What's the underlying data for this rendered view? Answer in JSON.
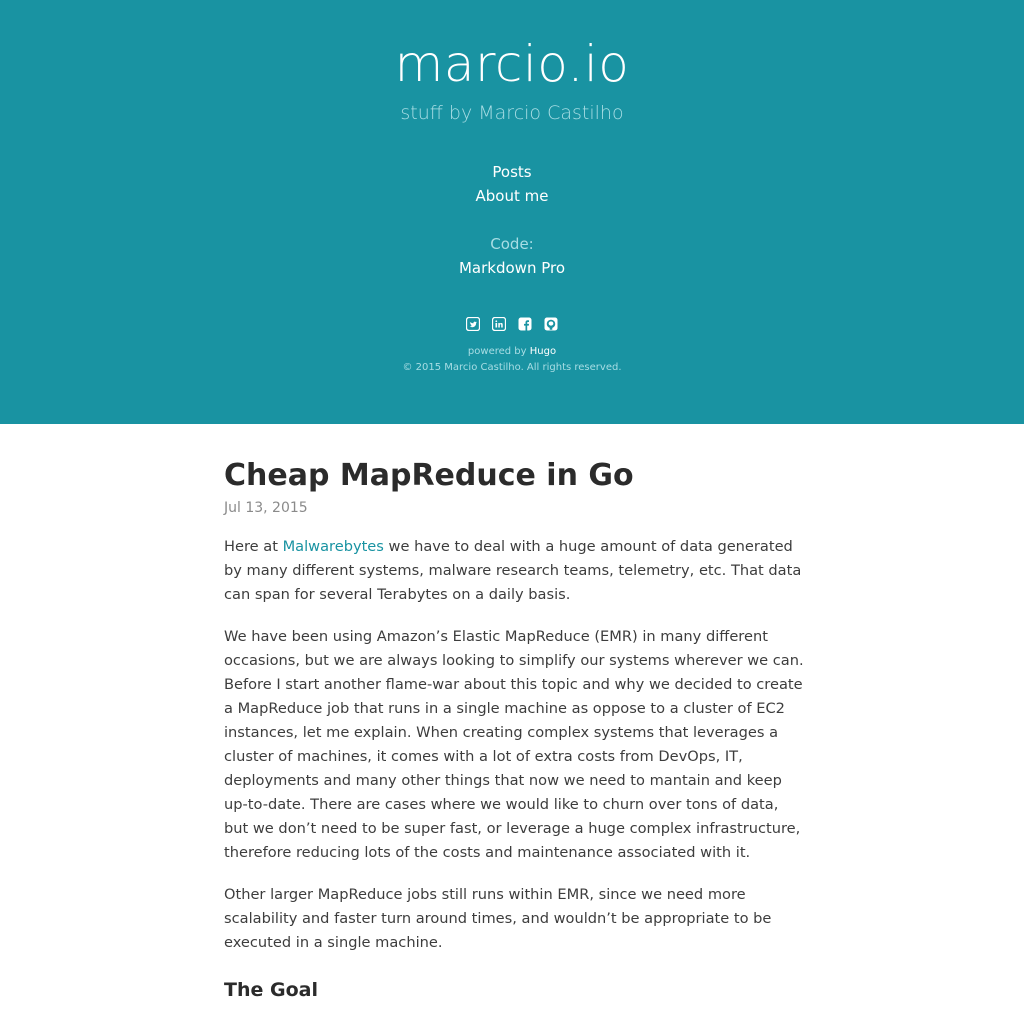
{
  "header": {
    "site_title": "marcio.io",
    "subtitle": "stuff by Marcio Castilho",
    "nav": {
      "posts": "Posts",
      "about": "About me",
      "code_label": "Code:",
      "markdown_pro": "Markdown Pro"
    },
    "social_icons": [
      "twitter-icon",
      "linkedin-icon",
      "facebook-icon",
      "github-icon"
    ],
    "powered_prefix": "powered by ",
    "powered_link": "Hugo",
    "copyright": "© 2015 Marcio Castilho. All rights reserved."
  },
  "post": {
    "title": "Cheap MapReduce in Go",
    "date": "Jul 13, 2015",
    "p1_prefix": "Here at ",
    "p1_link": "Malwarebytes",
    "p1_suffix": " we have to deal with a huge amount of data generated by many different systems, malware research teams, telemetry, etc. That data can span for several Terabytes on a daily basis.",
    "p2": "We have been using Amazon’s Elastic MapReduce (EMR) in many different occasions, but we are always looking to simplify our systems wherever we can. Before I start another flame-war about this topic and why we decided to create a MapReduce job that runs in a single machine as oppose to a cluster of EC2 instances, let me explain. When creating complex systems that leverages a cluster of machines, it comes with a lot of extra costs from DevOps, IT, deployments and many other things that now we need to mantain and keep up-to-date. There are cases where we would like to churn over tons of data, but we don’t need to be super fast, or leverage a huge complex infrastructure, therefore reducing lots of the costs and maintenance associated with it.",
    "p3": "Other larger MapReduce jobs still runs within EMR, since we need more scalability and faster turn around times, and wouldn’t be appropriate to be executed in a single machine.",
    "h2_goal": "The Goal"
  },
  "colors": {
    "header_bg": "#1993a2",
    "link": "#1993a2",
    "muted_header_text": "#a8dde4"
  }
}
